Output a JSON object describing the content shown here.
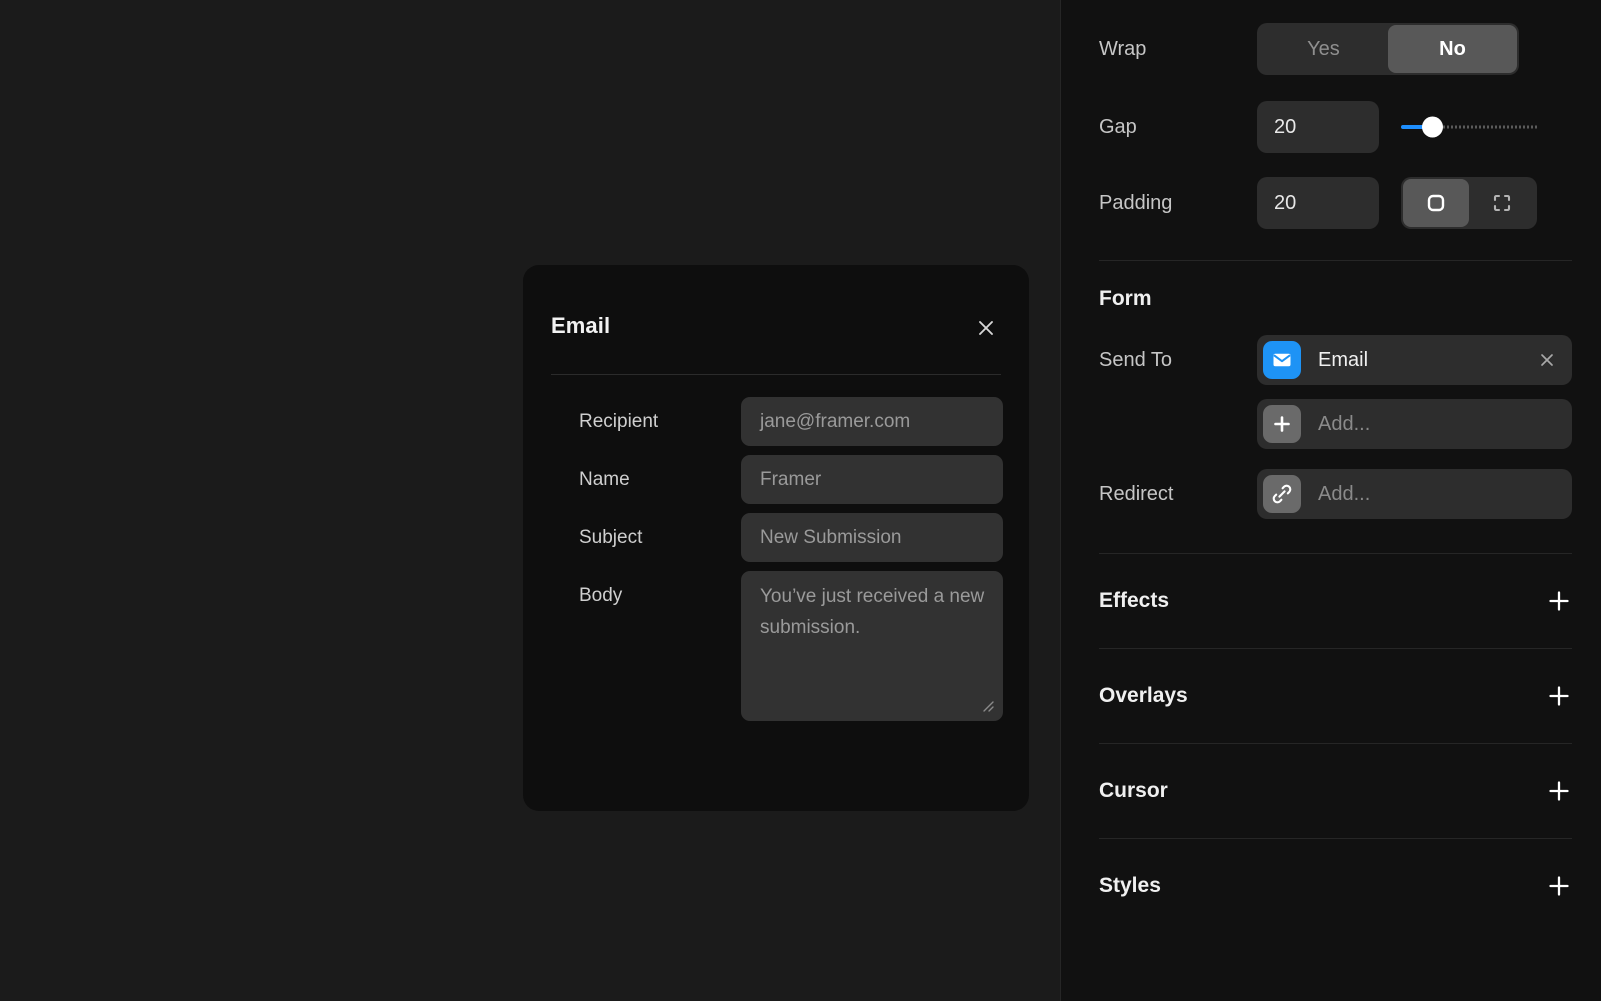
{
  "canvas": {
    "dialog": {
      "title": "Email",
      "close_icon": "close-icon",
      "fields": [
        {
          "label": "Recipient",
          "value": "jane@framer.com",
          "type": "text"
        },
        {
          "label": "Name",
          "value": "Framer",
          "type": "text"
        },
        {
          "label": "Subject",
          "value": "New Submission",
          "type": "text"
        },
        {
          "label": "Body",
          "value": "You’ve just received a new submission.",
          "type": "textarea"
        }
      ]
    }
  },
  "panel": {
    "layout": {
      "wrap": {
        "label": "Wrap",
        "options": [
          "Yes",
          "No"
        ],
        "selected": "No"
      },
      "gap": {
        "label": "Gap",
        "value": "20",
        "slider_percent": 20
      },
      "padding": {
        "label": "Padding",
        "value": "20",
        "modes": [
          "padding-all-icon",
          "padding-individual-icon"
        ],
        "selected_mode": "padding-all-icon"
      }
    },
    "form": {
      "title": "Form",
      "send_to": {
        "label": "Send To",
        "items": [
          {
            "icon": "mail-icon",
            "text": "Email",
            "removable": true
          }
        ],
        "add_placeholder": "Add...",
        "add_icon": "plus-icon"
      },
      "redirect": {
        "label": "Redirect",
        "placeholder": "Add...",
        "icon": "link-icon"
      }
    },
    "sections": [
      {
        "title": "Effects",
        "action_icon": "plus-icon"
      },
      {
        "title": "Overlays",
        "action_icon": "plus-icon"
      },
      {
        "title": "Cursor",
        "action_icon": "plus-icon"
      },
      {
        "title": "Styles",
        "action_icon": "plus-icon"
      }
    ]
  },
  "colors": {
    "accent": "#1e8fff",
    "mail_icon_bg": "#1e93f5",
    "panel_bg": "#111111",
    "canvas_bg": "#1b1b1b",
    "dialog_bg": "#0e0e0e",
    "field_bg": "#323232"
  }
}
